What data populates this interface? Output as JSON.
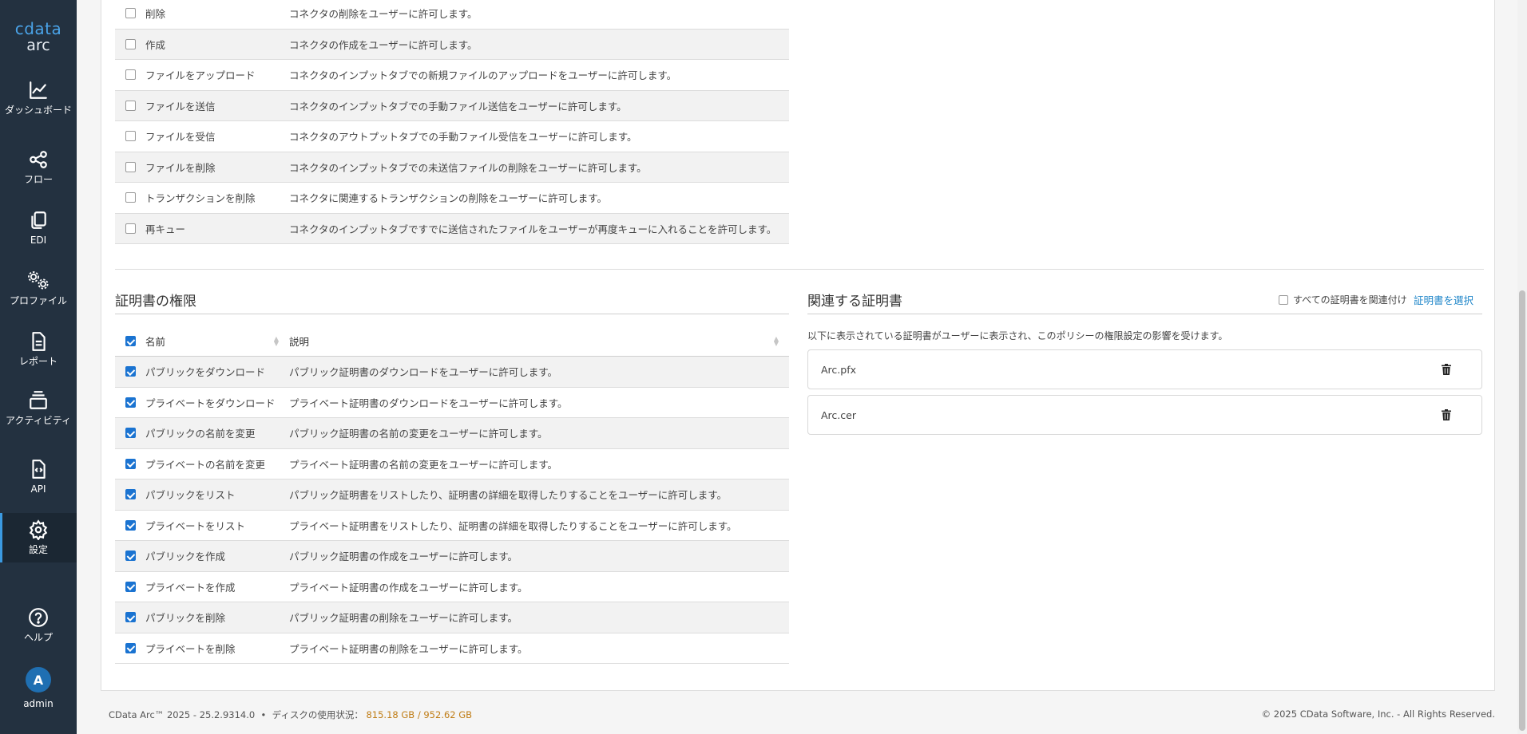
{
  "brand": {
    "logo_top": "cdata",
    "logo_bottom": "arc"
  },
  "nav": {
    "dashboard": "ダッシュボード",
    "flow": "フロー",
    "edi": "EDI",
    "profile": "プロファイル",
    "report": "レポート",
    "activity": "アクティビティ",
    "api": "API",
    "settings": "設定",
    "help": "ヘルプ",
    "user_initial": "A",
    "user_name": "admin"
  },
  "connector_permissions": [
    {
      "name": "削除",
      "desc": "コネクタの削除をユーザーに許可します。",
      "checked": false
    },
    {
      "name": "作成",
      "desc": "コネクタの作成をユーザーに許可します。",
      "checked": false
    },
    {
      "name": "ファイルをアップロード",
      "desc": "コネクタのインプットタブでの新規ファイルのアップロードをユーザーに許可します。",
      "checked": false
    },
    {
      "name": "ファイルを送信",
      "desc": "コネクタのインプットタブでの手動ファイル送信をユーザーに許可します。",
      "checked": false
    },
    {
      "name": "ファイルを受信",
      "desc": "コネクタのアウトプットタブでの手動ファイル受信をユーザーに許可します。",
      "checked": false
    },
    {
      "name": "ファイルを削除",
      "desc": "コネクタのインプットタブでの未送信ファイルの削除をユーザーに許可します。",
      "checked": false
    },
    {
      "name": "トランザクションを削除",
      "desc": "コネクタに関連するトランザクションの削除をユーザーに許可します。",
      "checked": false
    },
    {
      "name": "再キュー",
      "desc": "コネクタのインプットタブですでに送信されたファイルをユーザーが再度キューに入れることを許可します。",
      "checked": false
    }
  ],
  "cert_permissions": {
    "title": "証明書の権限",
    "col_name": "名前",
    "col_desc": "説明",
    "header_checked": true,
    "rows": [
      {
        "name": "パブリックをダウンロード",
        "desc": "パブリック証明書のダウンロードをユーザーに許可します。",
        "checked": true
      },
      {
        "name": "プライベートをダウンロード",
        "desc": "プライベート証明書のダウンロードをユーザーに許可します。",
        "checked": true
      },
      {
        "name": "パブリックの名前を変更",
        "desc": "パブリック証明書の名前の変更をユーザーに許可します。",
        "checked": true
      },
      {
        "name": "プライベートの名前を変更",
        "desc": "プライベート証明書の名前の変更をユーザーに許可します。",
        "checked": true
      },
      {
        "name": "パブリックをリスト",
        "desc": "パブリック証明書をリストしたり、証明書の詳細を取得したりすることをユーザーに許可します。",
        "checked": true
      },
      {
        "name": "プライベートをリスト",
        "desc": "プライベート証明書をリストしたり、証明書の詳細を取得したりすることをユーザーに許可します。",
        "checked": true
      },
      {
        "name": "パブリックを作成",
        "desc": "パブリック証明書の作成をユーザーに許可します。",
        "checked": true
      },
      {
        "name": "プライベートを作成",
        "desc": "プライベート証明書の作成をユーザーに許可します。",
        "checked": true
      },
      {
        "name": "パブリックを削除",
        "desc": "パブリック証明書の削除をユーザーに許可します。",
        "checked": true
      },
      {
        "name": "プライベートを削除",
        "desc": "プライベート証明書の削除をユーザーに許可します。",
        "checked": true
      }
    ]
  },
  "related_certs": {
    "title": "関連する証明書",
    "associate_all_label": "すべての証明書を関連付け",
    "associate_all_checked": false,
    "select_link": "証明書を選択",
    "description": "以下に表示されている証明書がユーザーに表示され、このポリシーの権限設定の影響を受けます。",
    "certs": [
      "Arc.pfx",
      "Arc.cer"
    ]
  },
  "footer": {
    "version": "CData Arc™ 2025 - 25.2.9314.0",
    "separator": "•",
    "disk_label": "ディスクの使用状況：",
    "disk_value": "815.18 GB / 952.62 GB",
    "copyright": "© 2025 CData Software, Inc. - All Rights Reserved."
  },
  "colors": {
    "sidebar_bg": "#233140",
    "accent": "#1a73d1",
    "link": "#1f86c9",
    "disk_value": "#c07d16"
  }
}
